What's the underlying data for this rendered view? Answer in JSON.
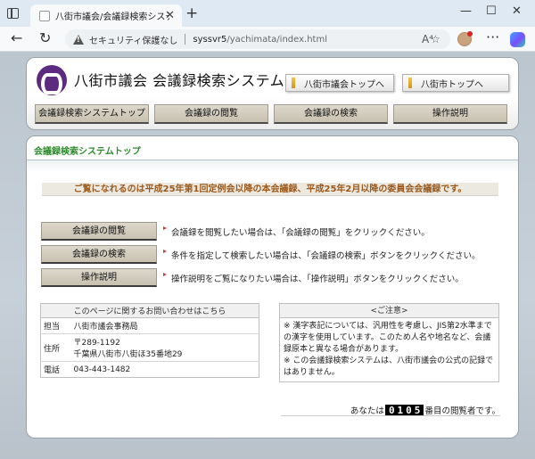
{
  "browser": {
    "tab_title": "八街市議会/会議録検索システム",
    "tab_close": "✕",
    "new_tab": "+",
    "window_controls": [
      "—",
      "☐",
      "✕"
    ],
    "security_label": "セキュリティ保護なし",
    "url_host": "syssvr5",
    "url_path": "/yachimata/index.html",
    "read_aloud": "A⁴",
    "more": "···"
  },
  "header": {
    "site_title": "八街市議会 会議録検索システム",
    "links": [
      "八街市議会トップへ",
      "八街市トップへ"
    ],
    "nav": [
      "会議録検索システムトップ",
      "会議録の閲覧",
      "会議録の検索",
      "操作説明"
    ]
  },
  "main": {
    "section_title": "会議録検索システムトップ",
    "notice": "ご覧になれるのは平成25年第1回定例会以降の本会議録、平成25年2月以降の委員会会議録です。",
    "actions": [
      {
        "label": "会議録の閲覧",
        "desc": "会議録を閲覧したい場合は、「会議録の閲覧」をクリックください。"
      },
      {
        "label": "会議録の検索",
        "desc": "条件を指定して検索したい場合は、「会議録の検索」ボタンをクリックください。"
      },
      {
        "label": "操作説明",
        "desc": "操作説明をご覧になりたい場合は、「操作説明」ボタンをクリックください。"
      }
    ]
  },
  "contact": {
    "heading": "このページに関するお問い合わせはこちら",
    "rows": [
      {
        "key": "担当",
        "value": "八街市議会事務局"
      },
      {
        "key": "住所",
        "value": "〒289-1192",
        "value2": "千葉県八街市八街ほ35番地29"
      },
      {
        "key": "電話",
        "value": "043-443-1482"
      }
    ]
  },
  "caution": {
    "heading": "<ご注意>",
    "lines": [
      "※ 漢字表記については、汎用性を考慮し、JIS第2水準までの漢字を使用しています。このため人名や地名など、会議録原本と異なる場合があります。",
      "※ この会議録検索システムは、八街市議会の公式の記録ではありません。"
    ]
  },
  "counter": {
    "prefix": "あなたは",
    "count": "0105",
    "suffix": "番目の閲覧者です。"
  }
}
